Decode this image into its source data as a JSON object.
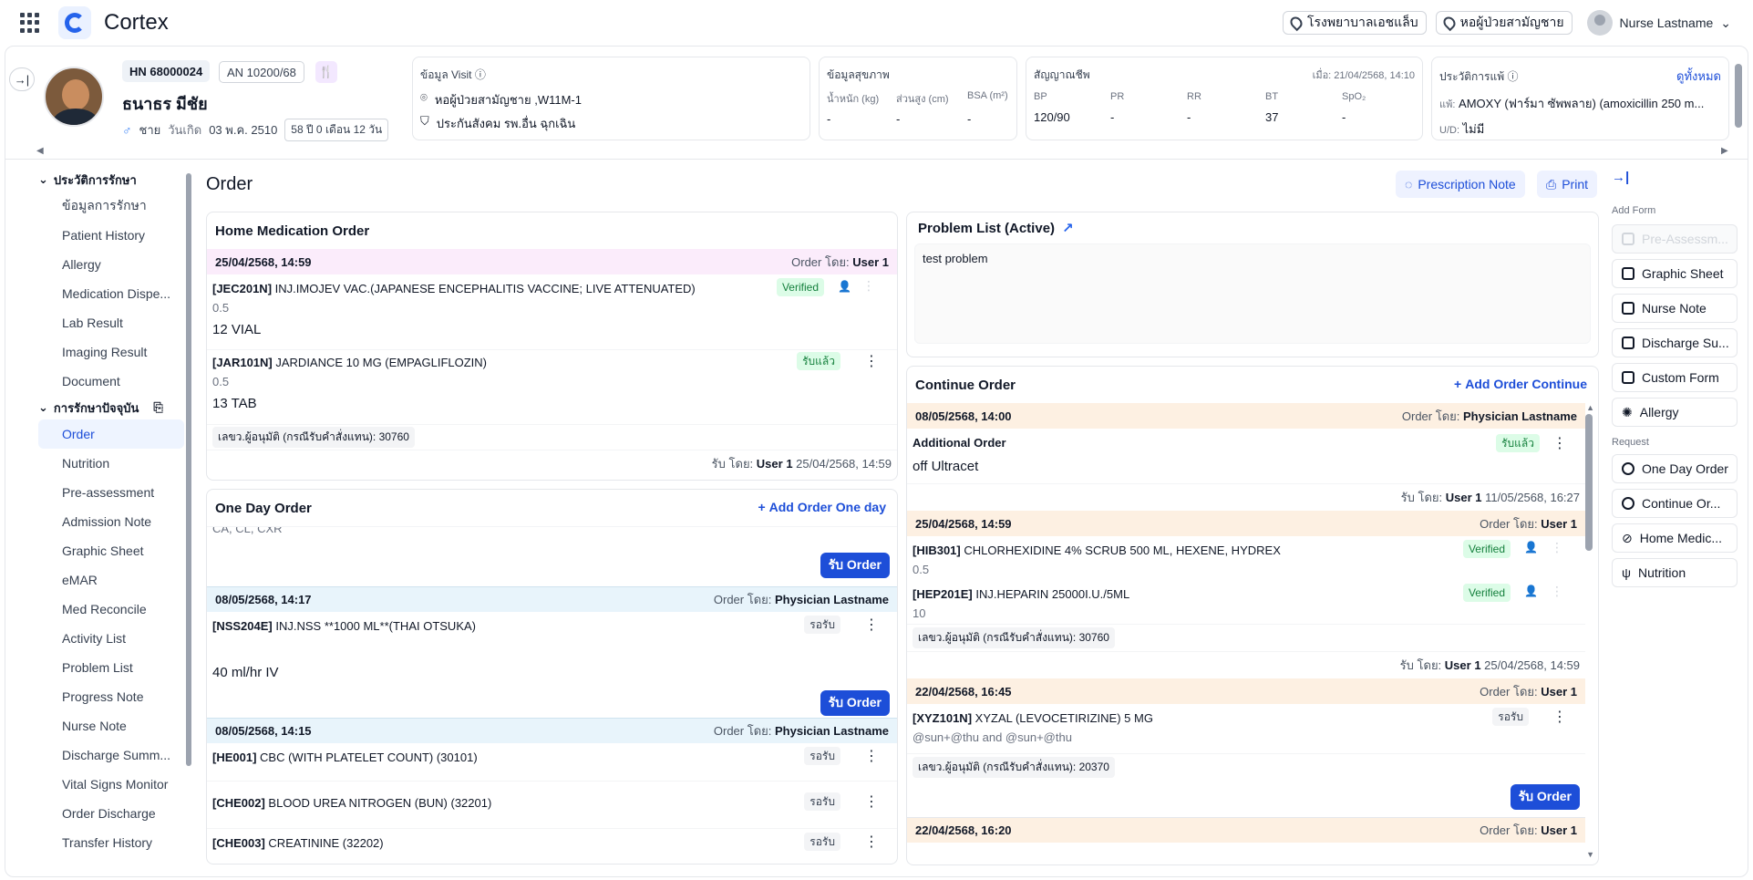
{
  "app": {
    "name": "Cortex"
  },
  "topbar": {
    "hospital": "โรงพยาบาลเอชแล็บ",
    "ward": "หอผู้ป่วยสามัญชาย",
    "user": "Nurse Lastname"
  },
  "patient": {
    "hn": "HN 68000024",
    "an": "AN 10200/68",
    "name": "ธนาธร มีชัย",
    "sex": "ชาย",
    "dob_label": "วันเกิด",
    "dob": "03 พ.ค. 2510",
    "age": "58 ปี 0 เดือน 12 วัน"
  },
  "visit": {
    "title": "ข้อมูล Visit",
    "ward": "หอผู้ป่วยสามัญชาย ,W11M-1",
    "coverage": "ประกันสังคม รพ.อื่น ฉุกเฉิน"
  },
  "health": {
    "title": "ข้อมูลสุขภาพ",
    "weight_label": "น้ำหนัก (kg)",
    "height_label": "ส่วนสูง (cm)",
    "bsa_label": "BSA (m²)",
    "weight": "-",
    "height": "-",
    "bsa": "-"
  },
  "vitals": {
    "title": "สัญญาณชีพ",
    "timestamp": "เมื่อ: 21/04/2568, 14:10",
    "labels": [
      "BP",
      "PR",
      "RR",
      "BT",
      "SpO₂"
    ],
    "values": [
      "120/90",
      "-",
      "-",
      "37",
      "-"
    ]
  },
  "allergy": {
    "title": "ประวัติการแพ้",
    "view_all": "ดูทั้งหมด",
    "allergy_label": "แพ้:",
    "allergy_text": "AMOXY (ฟาร์มา ซัพพลาย) (amoxicillin 250 m...",
    "ud_label": "U/D:",
    "ud_value": "ไม่มี"
  },
  "sidebar": {
    "section1": "ประวัติการรักษา",
    "history_items": [
      "ข้อมูลการรักษา",
      "Patient History",
      "Allergy",
      "Medication Dispe...",
      "Lab Result",
      "Imaging Result",
      "Document"
    ],
    "section2": "การรักษาปัจจุบัน",
    "current_items": [
      "Order",
      "Nutrition",
      "Pre-assessment",
      "Admission Note",
      "Graphic Sheet",
      "eMAR",
      "Med Reconcile",
      "Activity List",
      "Problem List",
      "Progress Note",
      "Nurse Note",
      "Discharge Summ...",
      "Vital Signs Monitor",
      "Order Discharge",
      "Transfer History"
    ]
  },
  "page": {
    "title": "Order",
    "prescription_note": "Prescription Note",
    "print": "Print"
  },
  "home_med": {
    "title": "Home Medication Order",
    "date": "25/04/2568, 14:59",
    "by_label": "Order โดย:",
    "by": "User 1",
    "items": [
      {
        "code": "[JEC201N]",
        "name": "INJ.IMOJEV VAC.(JAPANESE ENCEPHALITIS VACCINE; LIVE ATTENUATED)",
        "dose": "0.5",
        "qty": "12 VIAL",
        "status": "Verified"
      },
      {
        "code": "[JAR101N]",
        "name": "JARDIANCE 10 MG (EMPAGLIFLOZIN)",
        "dose": "0.5",
        "qty": "13 TAB",
        "status": "รับแล้ว"
      }
    ],
    "note": "เลขว.ผู้อนุมัติ (กรณีรับคำสั่งแทน): 30760",
    "recv_label": "รับ โดย:",
    "recv_by": "User 1",
    "recv_time": "25/04/2568, 14:59"
  },
  "one_day": {
    "title": "One Day Order",
    "add": "Add Order One day",
    "cut_text": "CA, CL, CXR",
    "accept": "รับ Order",
    "groups": [
      {
        "date": "08/05/2568, 14:17",
        "by_label": "Order โดย:",
        "by": "Physician Lastname",
        "items": [
          {
            "code": "[NSS204E]",
            "name": "INJ.NSS **1000 ML**(THAI OTSUKA)",
            "status": "รอรับ"
          }
        ],
        "extra": "40 ml/hr IV"
      },
      {
        "date": "08/05/2568, 14:15",
        "by_label": "Order โดย:",
        "by": "Physician Lastname",
        "items": [
          {
            "code": "[HE001]",
            "name": "CBC (WITH PLATELET COUNT) (30101)",
            "status": "รอรับ"
          },
          {
            "code": "[CHE002]",
            "name": "BLOOD UREA NITROGEN (BUN) (32201)",
            "status": "รอรับ"
          },
          {
            "code": "[CHE003]",
            "name": "CREATININE (32202)",
            "status": "รอรับ"
          }
        ]
      }
    ]
  },
  "problem": {
    "title": "Problem List (Active)",
    "items": [
      "test problem"
    ]
  },
  "continue": {
    "title": "Continue Order",
    "add": "Add Order Continue",
    "groups": [
      {
        "date": "08/05/2568, 14:00",
        "by_label": "Order โดย:",
        "by": "Physician Lastname",
        "item_title": "Additional Order",
        "status": "รับแล้ว",
        "text": "off Ultracet",
        "recv_label": "รับ โดย:",
        "recv_by": "User 1",
        "recv_time": "11/05/2568, 16:27"
      },
      {
        "date": "25/04/2568, 14:59",
        "by_label": "Order โดย:",
        "by": "User 1",
        "items": [
          {
            "code": "[HIB301]",
            "name": "CHLORHEXIDINE 4% SCRUB 500 ML, HEXENE, HYDREX",
            "dose": "0.5",
            "status": "Verified"
          },
          {
            "code": "[HEP201E]",
            "name": "INJ.HEPARIN 25000I.U./5ML",
            "dose": "10",
            "status": "Verified"
          }
        ],
        "note": "เลขว.ผู้อนุมัติ (กรณีรับคำสั่งแทน): 30760",
        "recv_label": "รับ โดย:",
        "recv_by": "User 1",
        "recv_time": "25/04/2568, 14:59"
      },
      {
        "date": "22/04/2568, 16:45",
        "by_label": "Order โดย:",
        "by": "User 1",
        "items": [
          {
            "code": "[XYZ101N]",
            "name": "XYZAL (LEVOCETIRIZINE) 5 MG",
            "dose": "@sun+@thu and @sun+@thu",
            "status": "รอรับ"
          }
        ],
        "note": "เลขว.ผู้อนุมัติ (กรณีรับคำสั่งแทน): 20370",
        "accept": "รับ Order"
      },
      {
        "date": "22/04/2568, 16:20",
        "by_label": "Order โดย:",
        "by": "User 1"
      }
    ]
  },
  "right_panel": {
    "add_form_label": "Add Form",
    "forms": [
      "Pre-Assessm...",
      "Graphic Sheet",
      "Nurse Note",
      "Discharge Su...",
      "Custom Form",
      "Allergy"
    ],
    "request_label": "Request",
    "requests": [
      "One Day Order",
      "Continue Or...",
      "Home Medic...",
      "Nutrition"
    ]
  }
}
